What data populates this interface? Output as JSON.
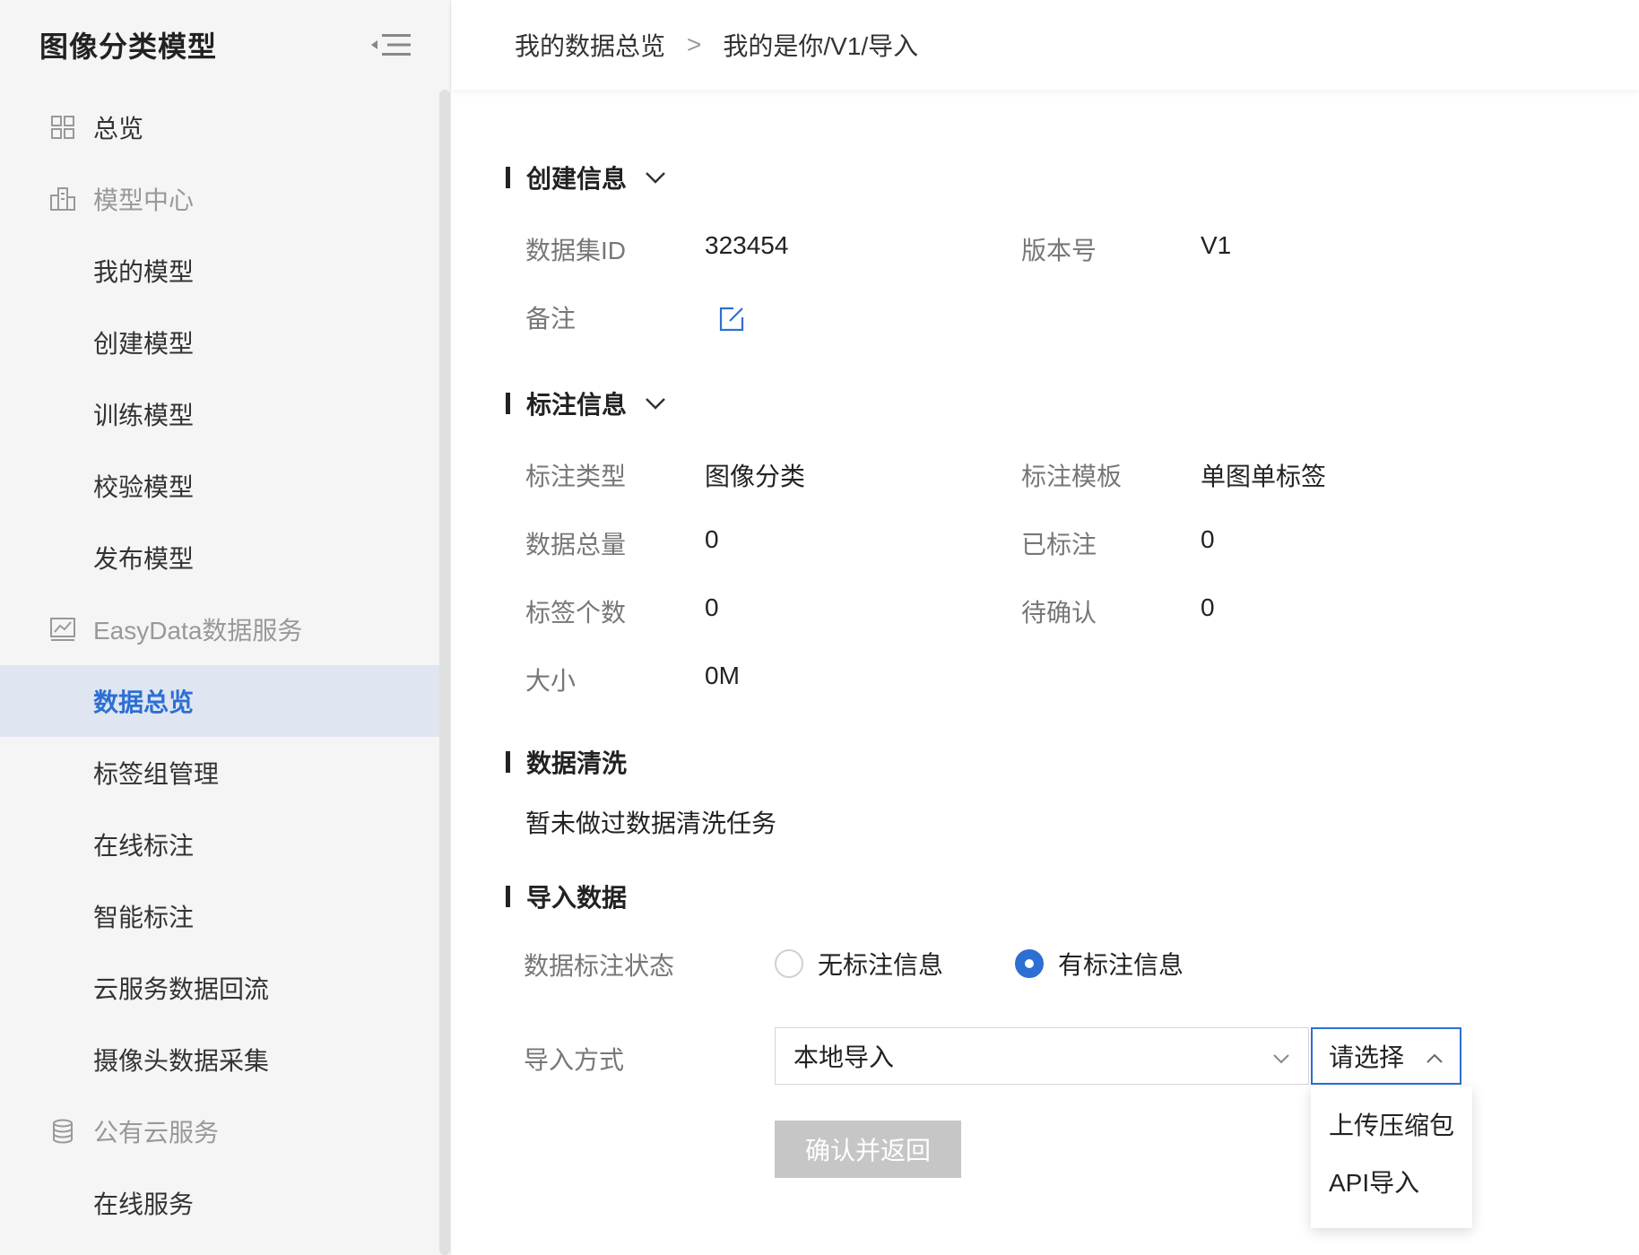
{
  "sidebar": {
    "title": "图像分类模型",
    "items": [
      {
        "label": "总览"
      },
      {
        "label": "模型中心"
      },
      {
        "label": "我的模型"
      },
      {
        "label": "创建模型"
      },
      {
        "label": "训练模型"
      },
      {
        "label": "校验模型"
      },
      {
        "label": "发布模型"
      },
      {
        "label": "EasyData数据服务"
      },
      {
        "label": "数据总览"
      },
      {
        "label": "标签组管理"
      },
      {
        "label": "在线标注"
      },
      {
        "label": "智能标注"
      },
      {
        "label": "云服务数据回流"
      },
      {
        "label": "摄像头数据采集"
      },
      {
        "label": "公有云服务"
      },
      {
        "label": "在线服务"
      }
    ]
  },
  "breadcrumb": {
    "first": "我的数据总览",
    "separator": ">",
    "second": "我的是你/V1/导入"
  },
  "create_info": {
    "title": "创建信息",
    "dataset_id_label": "数据集ID",
    "dataset_id": "323454",
    "version_label": "版本号",
    "version": "V1",
    "remark_label": "备注"
  },
  "annotation_info": {
    "title": "标注信息",
    "type_label": "标注类型",
    "type": "图像分类",
    "template_label": "标注模板",
    "template": "单图单标签",
    "total_label": "数据总量",
    "total": "0",
    "labeled_label": "已标注",
    "labeled": "0",
    "tag_count_label": "标签个数",
    "tag_count": "0",
    "pending_label": "待确认",
    "pending": "0",
    "size_label": "大小",
    "size": "0M"
  },
  "cleaning": {
    "title": "数据清洗",
    "empty_text": "暂未做过数据清洗任务"
  },
  "import": {
    "title": "导入数据",
    "status_label": "数据标注状态",
    "option_none": "无标注信息",
    "option_has": "有标注信息",
    "selected_option": "有标注信息",
    "method_label": "导入方式",
    "method_value": "本地导入",
    "sub_placeholder": "请选择",
    "dropdown_options": [
      "上传压缩包",
      "API导入"
    ],
    "confirm_label": "确认并返回"
  },
  "colors": {
    "accent": "#2d6fd3",
    "sidebar_bg": "#f5f5f5",
    "active_bg": "#dfe6f1",
    "disabled_btn": "#c6c6c6"
  }
}
